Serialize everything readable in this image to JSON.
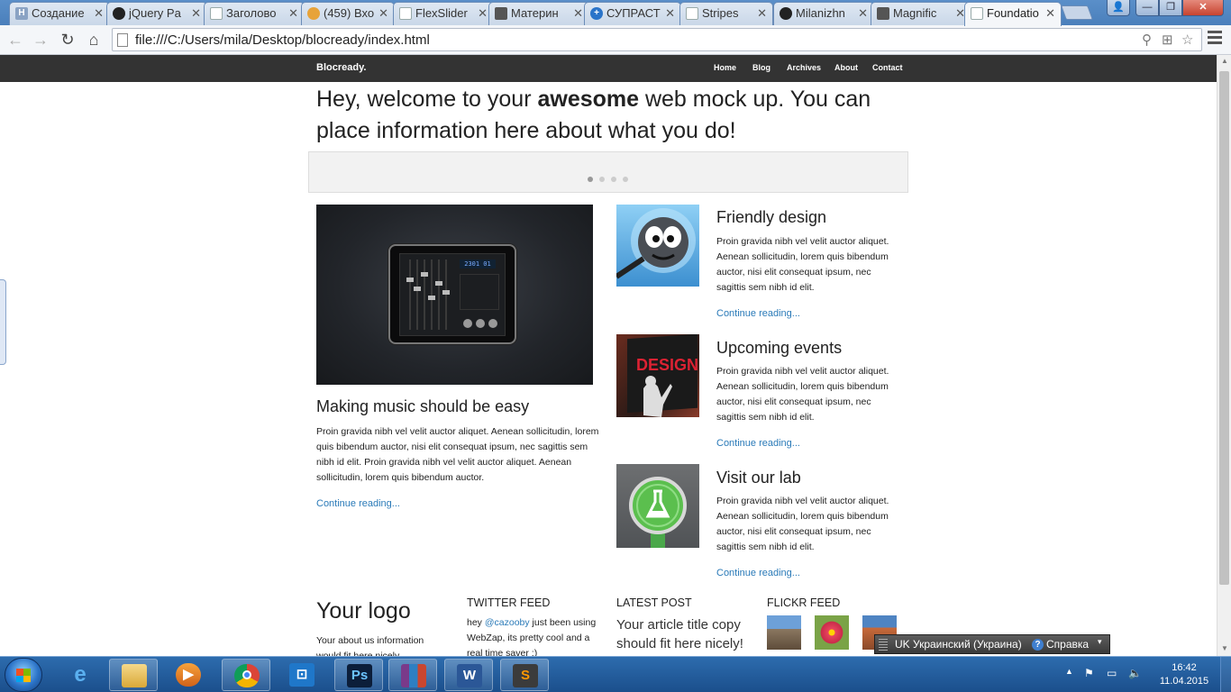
{
  "browser": {
    "tabs": [
      {
        "title": "Создание",
        "icon": "habr"
      },
      {
        "title": "jQuery Pa",
        "icon": "github"
      },
      {
        "title": "Заголово",
        "icon": "doc"
      },
      {
        "title": "(459) Вхо",
        "icon": "mail"
      },
      {
        "title": "FlexSlider",
        "icon": "doc"
      },
      {
        "title": "Материн",
        "icon": "material"
      },
      {
        "title": "СУПРАСТ",
        "icon": "plus"
      },
      {
        "title": "Stripes",
        "icon": "doc"
      },
      {
        "title": "Milanizhn",
        "icon": "github"
      },
      {
        "title": "Magnific",
        "icon": "magnific"
      },
      {
        "title": "Foundatio",
        "icon": "doc"
      }
    ],
    "url": "file:///C:/Users/mila/Desktop/blocready/index.html"
  },
  "site": {
    "brand": "Blocready.",
    "nav": [
      "Home",
      "Blog",
      "Archives",
      "About",
      "Contact"
    ],
    "lead_pre": "Hey, welcome to your ",
    "lead_bold": "awesome",
    "lead_post": " web mock up. You can place information here about what you do!",
    "slider": {
      "dots": 4,
      "active": 0
    },
    "mixer_display": "2301 01",
    "featured": {
      "title": "Making music should be easy",
      "body": "Proin gravida nibh vel velit auctor aliquet. Aenean sollicitudin, lorem quis bibendum auctor, nisi elit consequat ipsum, nec sagittis sem nibh id elit. Proin gravida nibh vel velit auctor aliquet. Aenean sollicitudin, lorem quis bibendum auctor.",
      "more": "Continue reading..."
    },
    "articles": [
      {
        "title": "Friendly design",
        "body": "Proin gravida nibh vel velit auctor aliquet. Aenean sollicitudin, lorem quis bibendum auctor, nisi elit consequat ipsum, nec sagittis sem nibh id elit.",
        "more": "Continue reading..."
      },
      {
        "title": "Upcoming events",
        "body": "Proin gravida nibh vel velit auctor aliquet. Aenean sollicitudin, lorem quis bibendum auctor, nisi elit consequat ipsum, nec sagittis sem nibh id elit.",
        "more": "Continue reading...",
        "poster_text": "DESIGN"
      },
      {
        "title": "Visit our lab",
        "body": "Proin gravida nibh vel velit auctor aliquet. Aenean sollicitudin, lorem quis bibendum auctor, nisi elit consequat ipsum, nec sagittis sem nibh id elit.",
        "more": "Continue reading..."
      }
    ],
    "footer": {
      "logo": "Your logo",
      "about": "Your about us information would fit here nicely.",
      "twitter_heading": "TWITTER FEED",
      "tweet_pre": "hey ",
      "tweet_mention": "@cazooby",
      "tweet_post": " just been using WebZap, its pretty cool and a real time saver :)",
      "latest_heading": "LATEST POST",
      "latest_title": "Your article title copy should fit here nicely!",
      "flickr_heading": "FLICKR FEED"
    }
  },
  "langbar": {
    "language": "UK Украинский (Украина)",
    "help": "Справка"
  },
  "taskbar": {
    "apps": [
      "internet-explorer",
      "file-explorer",
      "media-player",
      "chrome",
      "mailru-agent",
      "photoshop",
      "winrar",
      "word",
      "sublime-text"
    ],
    "time": "16:42",
    "date": "11.04.2015"
  },
  "colors": {
    "link": "#2a7ab8",
    "topbar": "#333333",
    "taskbar": "#1b4f8c"
  }
}
